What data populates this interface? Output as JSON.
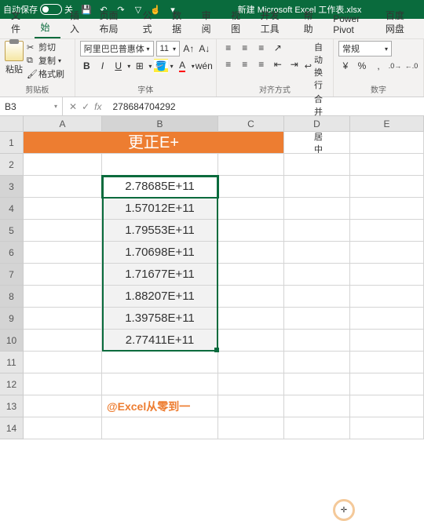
{
  "titlebar": {
    "autosave": "自动保存",
    "autosave_state": "关",
    "docname": "新建 Microsoft Excel 工作表.xlsx"
  },
  "tabs": {
    "file": "文件",
    "home": "开始",
    "insert": "插入",
    "layout": "页面布局",
    "formulas": "公式",
    "data": "数据",
    "review": "审阅",
    "view": "视图",
    "dev": "开发工具",
    "help": "帮助",
    "powerpivot": "Power Pivot",
    "baidu": "百度网盘"
  },
  "ribbon": {
    "paste": "粘贴",
    "cut": "剪切",
    "copy": "复制",
    "format_painter": "格式刷",
    "clipboard_label": "剪贴板",
    "font_name": "阿里巴巴普惠体",
    "font_size": "11",
    "font_label": "字体",
    "bold": "B",
    "italic": "I",
    "underline": "U",
    "wrap": "自动换行",
    "merge": "合并后居中",
    "align_label": "对齐方式",
    "num_format": "常规",
    "num_label": "数字",
    "currency": "¥",
    "percent": "%",
    "comma": ",",
    "inc": "+.0",
    "dec": ".0-"
  },
  "fbar": {
    "name": "B3",
    "check": "✓",
    "cancel": "✕",
    "fx": "fx",
    "value": "278684704292"
  },
  "cols": {
    "A": "A",
    "B": "B",
    "C": "C",
    "D": "D",
    "E": "E"
  },
  "rows": [
    "1",
    "2",
    "3",
    "4",
    "5",
    "6",
    "7",
    "8",
    "9",
    "10",
    "11",
    "12",
    "13",
    "14"
  ],
  "sheet": {
    "header": "更正E+",
    "data": [
      "2.78685E+11",
      "1.57012E+11",
      "1.79553E+11",
      "1.70698E+11",
      "1.71677E+11",
      "1.88207E+11",
      "1.39758E+11",
      "2.77411E+11"
    ],
    "watermark": "@Excel从零到一"
  },
  "cursor": "✛"
}
